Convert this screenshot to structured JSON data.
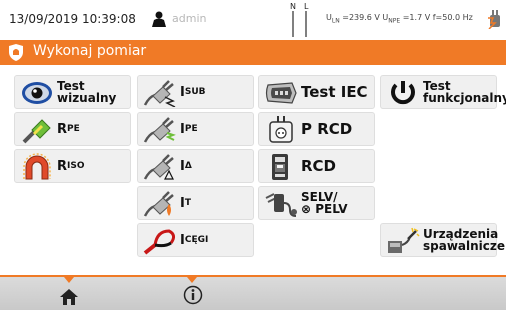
{
  "status": {
    "datetime": "13/09/2019 10:39:08",
    "user": "admin",
    "mains_n": "N",
    "mains_l": "L",
    "uln_label": "U",
    "uln_sub": "LN",
    "uln_value": " =239.6 V ",
    "upe_label": "U",
    "upe_sub": "NPE",
    "upe_value": " =1.7 V f=50.0 Hz"
  },
  "header": {
    "title": "Wykonaj pomiar"
  },
  "tiles": {
    "test_visual": {
      "line1": "Test",
      "line2": "wizualny"
    },
    "isub": {
      "main": "I",
      "sub": "SUB"
    },
    "test_iec": {
      "label": "Test IEC"
    },
    "test_functional": {
      "line1": "Test",
      "line2": "funkcjonalny"
    },
    "rpe": {
      "main": "R",
      "sub": "PE"
    },
    "ipe": {
      "main": "I",
      "sub": "PE"
    },
    "prcd": {
      "label": "P RCD"
    },
    "riso": {
      "main": "R",
      "sub": "ISO"
    },
    "idelta": {
      "main": "I",
      "sub": "Δ"
    },
    "rcd": {
      "label": "RCD"
    },
    "it": {
      "main": "I",
      "sub": "T"
    },
    "selv": {
      "line1": "SELV/",
      "line2": "PELV"
    },
    "icegi": {
      "main": "I",
      "sub": "CĘGI"
    },
    "welding": {
      "line1": "Urządzenia",
      "line2": "spawalnicze"
    }
  },
  "colors": {
    "accent": "#f07a26",
    "tile_bg": "#f0f0f0",
    "bottom_bg": "#d2d2d2"
  },
  "icons": {
    "eye": "eye-icon",
    "plug": "plug-current-icon",
    "iec": "iec-socket-icon",
    "power": "power-icon",
    "rpe": "pe-resistance-icon",
    "socket": "socket-icon",
    "riso": "insulation-icon",
    "rcd": "rcd-device-icon",
    "selv": "adapter-icon",
    "clamp": "clamp-icon",
    "welding": "welding-icon",
    "home": "home-icon",
    "info": "info-icon"
  }
}
